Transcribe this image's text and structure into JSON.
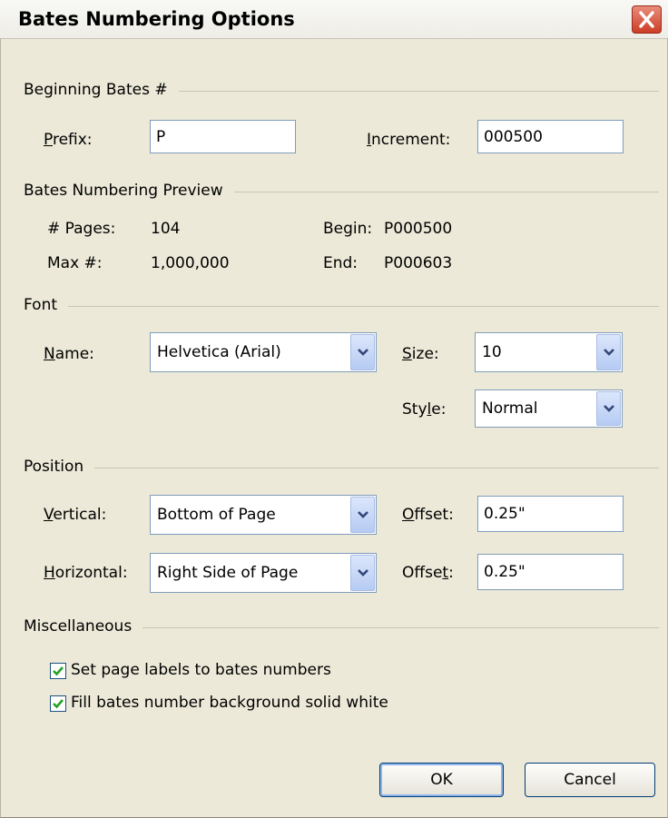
{
  "window": {
    "title": "Bates Numbering Options"
  },
  "beginning": {
    "heading": "Beginning Bates #",
    "prefix_label": [
      "",
      "P",
      "refix:"
    ],
    "prefix_value": "P",
    "increment_label": [
      "",
      "I",
      "ncrement:"
    ],
    "increment_value": "000500"
  },
  "preview": {
    "heading": "Bates Numbering Preview",
    "pages_label": "# Pages:",
    "pages_value": "104",
    "max_label": "Max #:",
    "max_value": "1,000,000",
    "begin_label": "Begin:",
    "begin_value": "P000500",
    "end_label": "End:",
    "end_value": "P000603"
  },
  "font": {
    "heading": "Font",
    "name_label": [
      "",
      "N",
      "ame:"
    ],
    "name_value": "Helvetica (Arial)",
    "size_label": [
      "",
      "S",
      "ize:"
    ],
    "size_value": "10",
    "style_label": [
      "Sty",
      "l",
      "e:"
    ],
    "style_value": "Normal"
  },
  "position": {
    "heading": "Position",
    "vertical_label": [
      "",
      "V",
      "ertical:"
    ],
    "vertical_value": "Bottom of Page",
    "v_offset_label": [
      "",
      "O",
      "ffset:"
    ],
    "v_offset_value": "0.25\"",
    "horizontal_label": [
      "",
      "H",
      "orizontal:"
    ],
    "horizontal_value": "Right Side of Page",
    "h_offset_label": [
      "Offse",
      "t",
      ":"
    ],
    "h_offset_value": "0.25\""
  },
  "misc": {
    "heading": "Miscellaneous",
    "opt1_label": "Set page labels to bates numbers",
    "opt1_checked": true,
    "opt2_label": "Fill bates number background solid white",
    "opt2_checked": true
  },
  "buttons": {
    "ok": "OK",
    "cancel": "Cancel"
  },
  "icons": {
    "close": "close-icon",
    "dropdown": "chevron-down-icon",
    "check": "checkmark-icon"
  },
  "colors": {
    "close_button": "#cc3d26",
    "checkmark": "#21a121",
    "field_border": "#7f9db9",
    "dialog_bg": "#ece9d8"
  }
}
